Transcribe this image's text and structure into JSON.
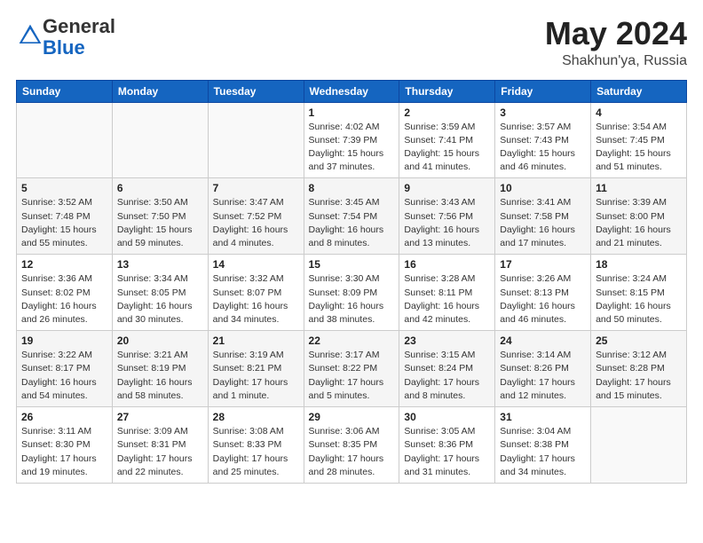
{
  "logo": {
    "general": "General",
    "blue": "Blue"
  },
  "title": {
    "month_year": "May 2024",
    "location": "Shakhun'ya, Russia"
  },
  "days_of_week": [
    "Sunday",
    "Monday",
    "Tuesday",
    "Wednesday",
    "Thursday",
    "Friday",
    "Saturday"
  ],
  "weeks": [
    [
      {
        "day": "",
        "info": ""
      },
      {
        "day": "",
        "info": ""
      },
      {
        "day": "",
        "info": ""
      },
      {
        "day": "1",
        "info": "Sunrise: 4:02 AM\nSunset: 7:39 PM\nDaylight: 15 hours\nand 37 minutes."
      },
      {
        "day": "2",
        "info": "Sunrise: 3:59 AM\nSunset: 7:41 PM\nDaylight: 15 hours\nand 41 minutes."
      },
      {
        "day": "3",
        "info": "Sunrise: 3:57 AM\nSunset: 7:43 PM\nDaylight: 15 hours\nand 46 minutes."
      },
      {
        "day": "4",
        "info": "Sunrise: 3:54 AM\nSunset: 7:45 PM\nDaylight: 15 hours\nand 51 minutes."
      }
    ],
    [
      {
        "day": "5",
        "info": "Sunrise: 3:52 AM\nSunset: 7:48 PM\nDaylight: 15 hours\nand 55 minutes."
      },
      {
        "day": "6",
        "info": "Sunrise: 3:50 AM\nSunset: 7:50 PM\nDaylight: 15 hours\nand 59 minutes."
      },
      {
        "day": "7",
        "info": "Sunrise: 3:47 AM\nSunset: 7:52 PM\nDaylight: 16 hours\nand 4 minutes."
      },
      {
        "day": "8",
        "info": "Sunrise: 3:45 AM\nSunset: 7:54 PM\nDaylight: 16 hours\nand 8 minutes."
      },
      {
        "day": "9",
        "info": "Sunrise: 3:43 AM\nSunset: 7:56 PM\nDaylight: 16 hours\nand 13 minutes."
      },
      {
        "day": "10",
        "info": "Sunrise: 3:41 AM\nSunset: 7:58 PM\nDaylight: 16 hours\nand 17 minutes."
      },
      {
        "day": "11",
        "info": "Sunrise: 3:39 AM\nSunset: 8:00 PM\nDaylight: 16 hours\nand 21 minutes."
      }
    ],
    [
      {
        "day": "12",
        "info": "Sunrise: 3:36 AM\nSunset: 8:02 PM\nDaylight: 16 hours\nand 26 minutes."
      },
      {
        "day": "13",
        "info": "Sunrise: 3:34 AM\nSunset: 8:05 PM\nDaylight: 16 hours\nand 30 minutes."
      },
      {
        "day": "14",
        "info": "Sunrise: 3:32 AM\nSunset: 8:07 PM\nDaylight: 16 hours\nand 34 minutes."
      },
      {
        "day": "15",
        "info": "Sunrise: 3:30 AM\nSunset: 8:09 PM\nDaylight: 16 hours\nand 38 minutes."
      },
      {
        "day": "16",
        "info": "Sunrise: 3:28 AM\nSunset: 8:11 PM\nDaylight: 16 hours\nand 42 minutes."
      },
      {
        "day": "17",
        "info": "Sunrise: 3:26 AM\nSunset: 8:13 PM\nDaylight: 16 hours\nand 46 minutes."
      },
      {
        "day": "18",
        "info": "Sunrise: 3:24 AM\nSunset: 8:15 PM\nDaylight: 16 hours\nand 50 minutes."
      }
    ],
    [
      {
        "day": "19",
        "info": "Sunrise: 3:22 AM\nSunset: 8:17 PM\nDaylight: 16 hours\nand 54 minutes."
      },
      {
        "day": "20",
        "info": "Sunrise: 3:21 AM\nSunset: 8:19 PM\nDaylight: 16 hours\nand 58 minutes."
      },
      {
        "day": "21",
        "info": "Sunrise: 3:19 AM\nSunset: 8:21 PM\nDaylight: 17 hours\nand 1 minute."
      },
      {
        "day": "22",
        "info": "Sunrise: 3:17 AM\nSunset: 8:22 PM\nDaylight: 17 hours\nand 5 minutes."
      },
      {
        "day": "23",
        "info": "Sunrise: 3:15 AM\nSunset: 8:24 PM\nDaylight: 17 hours\nand 8 minutes."
      },
      {
        "day": "24",
        "info": "Sunrise: 3:14 AM\nSunset: 8:26 PM\nDaylight: 17 hours\nand 12 minutes."
      },
      {
        "day": "25",
        "info": "Sunrise: 3:12 AM\nSunset: 8:28 PM\nDaylight: 17 hours\nand 15 minutes."
      }
    ],
    [
      {
        "day": "26",
        "info": "Sunrise: 3:11 AM\nSunset: 8:30 PM\nDaylight: 17 hours\nand 19 minutes."
      },
      {
        "day": "27",
        "info": "Sunrise: 3:09 AM\nSunset: 8:31 PM\nDaylight: 17 hours\nand 22 minutes."
      },
      {
        "day": "28",
        "info": "Sunrise: 3:08 AM\nSunset: 8:33 PM\nDaylight: 17 hours\nand 25 minutes."
      },
      {
        "day": "29",
        "info": "Sunrise: 3:06 AM\nSunset: 8:35 PM\nDaylight: 17 hours\nand 28 minutes."
      },
      {
        "day": "30",
        "info": "Sunrise: 3:05 AM\nSunset: 8:36 PM\nDaylight: 17 hours\nand 31 minutes."
      },
      {
        "day": "31",
        "info": "Sunrise: 3:04 AM\nSunset: 8:38 PM\nDaylight: 17 hours\nand 34 minutes."
      },
      {
        "day": "",
        "info": ""
      }
    ]
  ]
}
